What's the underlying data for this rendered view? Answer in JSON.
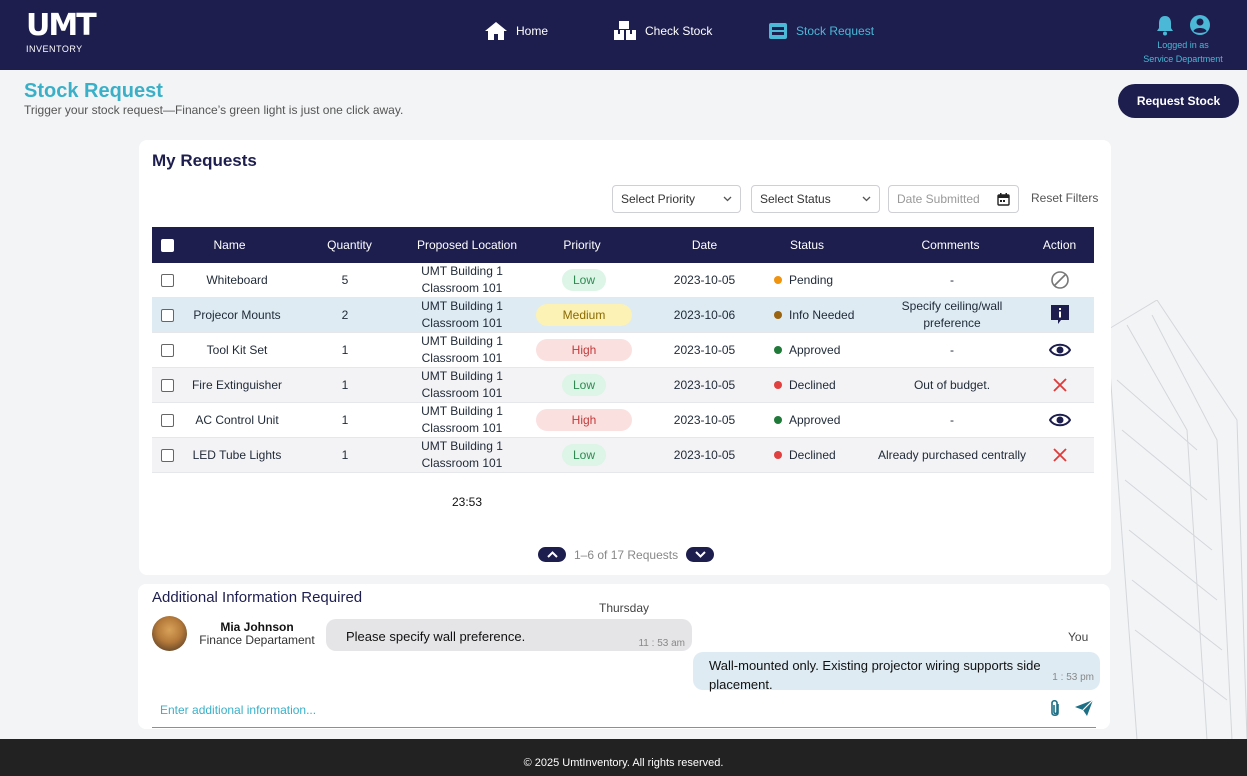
{
  "logo": {
    "mark": "UMT",
    "text": "INVENTORY"
  },
  "nav": [
    {
      "label": "Home",
      "icon": "home-icon"
    },
    {
      "label": "Check Stock",
      "icon": "boxes-icon"
    },
    {
      "label": "Stock Request",
      "icon": "inbox-icon",
      "active": true
    }
  ],
  "user": {
    "logged_line1": "Logged in as",
    "logged_line2": "Service Department"
  },
  "page": {
    "title": "Stock Request",
    "subtitle": "Trigger your stock request—Finance’s green light is just one click away.",
    "request_button": "Request Stock"
  },
  "requests": {
    "title": "My Requests",
    "filters": {
      "priority": "Select Priority",
      "status": "Select Status",
      "date_placeholder": "Date Submitted",
      "reset": "Reset Filters"
    },
    "columns": [
      "Name",
      "Quantity",
      "Proposed Location",
      "Priority",
      "Date",
      "Status",
      "Comments",
      "Action"
    ],
    "rows": [
      {
        "name": "Whiteboard",
        "qty": "5",
        "loc1": "UMT Building 1",
        "loc2": "Classroom 101",
        "priority": "Low",
        "date": "2023-10-05",
        "status": "Pending",
        "comment": "-",
        "action": "cancel-icon"
      },
      {
        "name": "Projecor Mounts",
        "qty": "2",
        "loc1": "UMT Building 1",
        "loc2": "Classroom 101",
        "priority": "Medium",
        "date": "2023-10-06",
        "status": "Info Needed",
        "comment": "Specify ceiling/wall preference",
        "action": "info-message-icon"
      },
      {
        "name": "Tool Kit Set",
        "qty": "1",
        "loc1": "UMT Building 1",
        "loc2": "Classroom 101",
        "priority": "High",
        "date": "2023-10-05",
        "status": "Approved",
        "comment": "-",
        "action": "eye-icon"
      },
      {
        "name": "Fire Extinguisher",
        "qty": "1",
        "loc1": "UMT Building 1",
        "loc2": "Classroom 101",
        "priority": "Low",
        "date": "2023-10-05",
        "status": "Declined",
        "comment": "Out of budget.",
        "action": "close-icon"
      },
      {
        "name": "AC Control Unit",
        "qty": "1",
        "loc1": "UMT Building 1",
        "loc2": "Classroom 101",
        "priority": "High",
        "date": "2023-10-05",
        "status": "Approved",
        "comment": "-",
        "action": "eye-icon"
      },
      {
        "name": "LED Tube Lights",
        "qty": "1",
        "loc1": "UMT Building 1",
        "loc2": "Classroom 101",
        "priority": "Low",
        "date": "2023-10-05",
        "status": "Declined",
        "comment": "Already purchased centrally",
        "action": "close-icon"
      }
    ],
    "time_text": "23:53",
    "pagination": "1–6 of 17 Requests"
  },
  "colors": {
    "navy": "#1d1e4e",
    "accent": "#3ab0c8",
    "low_bg": "#dcf5e6",
    "low_fg": "#2e8a52",
    "medium_bg": "#fcf2b5",
    "medium_fg": "#8a6a00",
    "high_bg": "#fbe0e0",
    "high_fg": "#c23b3b",
    "pending": "#f0930e",
    "info": "#9a6310",
    "approved": "#1f7a3a",
    "declined": "#e04040"
  },
  "chat": {
    "title": "Additional Information Required",
    "day": "Thursday",
    "sender_name": "Mia Johnson",
    "sender_dept": "Finance Departament",
    "incoming": "Please specify wall preference.",
    "incoming_time": "11 : 53 am",
    "you": "You",
    "outgoing": "Wall-mounted only. Existing projector wiring supports side placement.",
    "outgoing_time": "1 : 53 pm",
    "input_placeholder": "Enter additional information..."
  },
  "footer": "© 2025 UmtInventory. All rights reserved."
}
